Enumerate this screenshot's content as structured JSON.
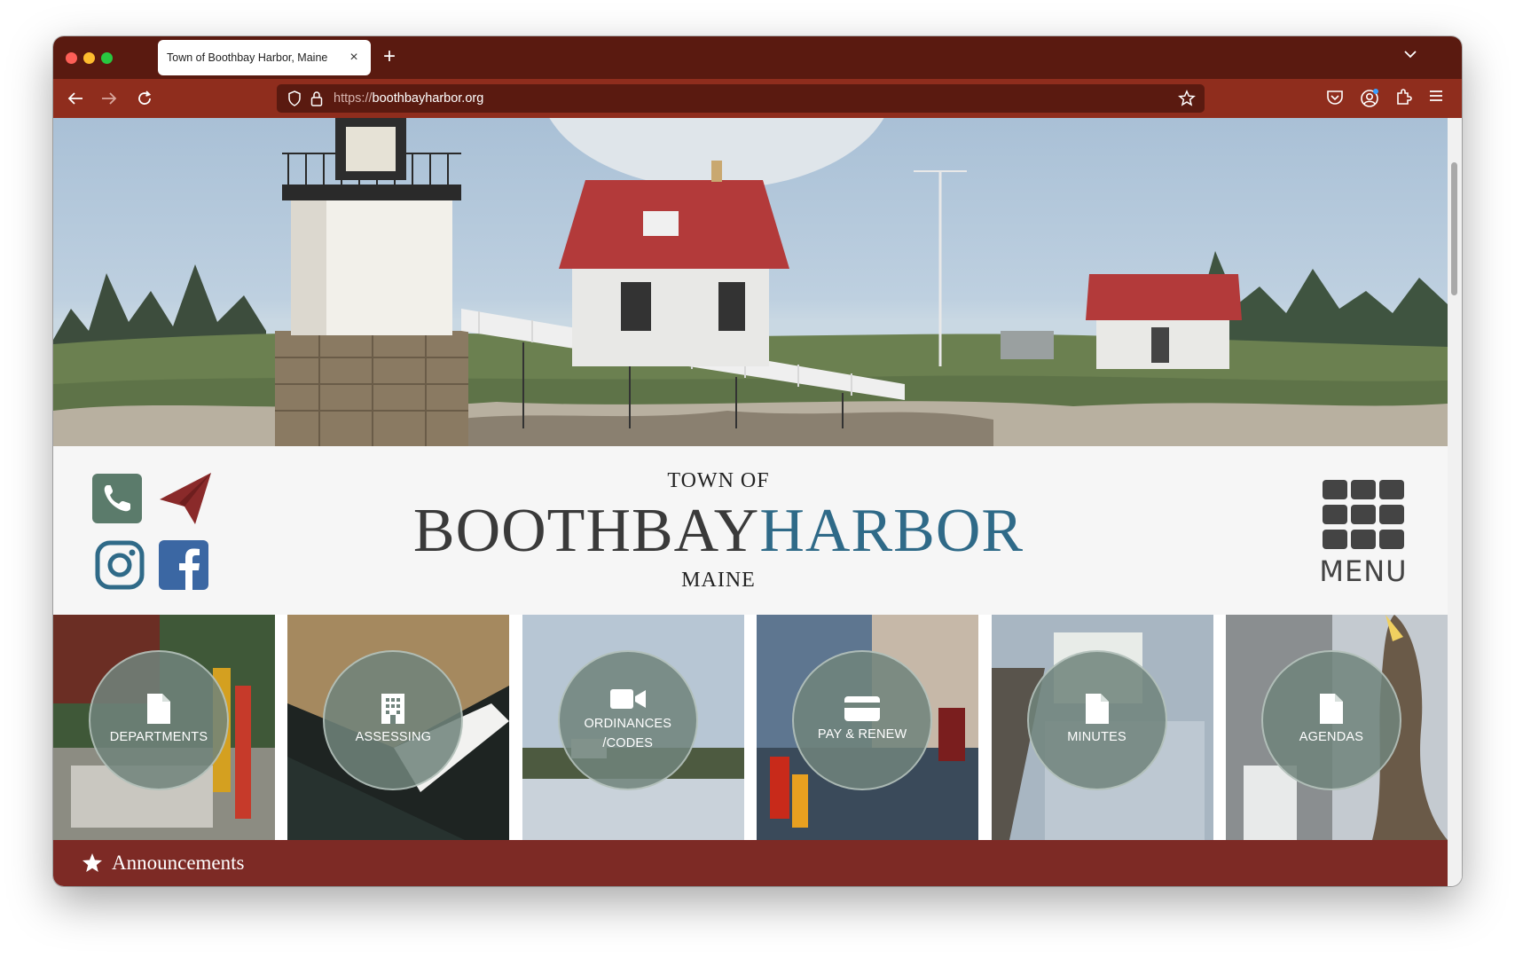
{
  "browser": {
    "tab_title": "Town of Boothbay Harbor, Maine",
    "tab_close": "×",
    "new_tab": "+",
    "url_prefix": "https://",
    "url_host": "boothbayharbor.org"
  },
  "site": {
    "brand_top": "TOWN OF",
    "brand_main_left": "BOOTHBAY",
    "brand_main_right": "HARBOR",
    "brand_bottom": "MAINE",
    "menu_label": "MENU",
    "tiles": [
      {
        "label": "DEPARTMENTS",
        "icon": "document-icon"
      },
      {
        "label": "ASSESSING",
        "icon": "building-icon"
      },
      {
        "label": "ORDINANCES /CODES",
        "icon": "video-camera-icon"
      },
      {
        "label": "PAY & RENEW",
        "icon": "credit-card-icon"
      },
      {
        "label": "MINUTES",
        "icon": "document-icon"
      },
      {
        "label": "AGENDAS",
        "icon": "document-icon"
      }
    ],
    "announcements_label": "Announcements"
  },
  "colors": {
    "tabstrip": "#5a1a10",
    "toolbar": "#8f2d1d",
    "harbor_blue": "#2f6a88",
    "announce_bar": "#7d2a25",
    "phone_green": "#5b7b6b",
    "send_red": "#8a2a2a",
    "instagram_blue": "#2f6a88",
    "facebook_blue": "#3b67a3"
  }
}
